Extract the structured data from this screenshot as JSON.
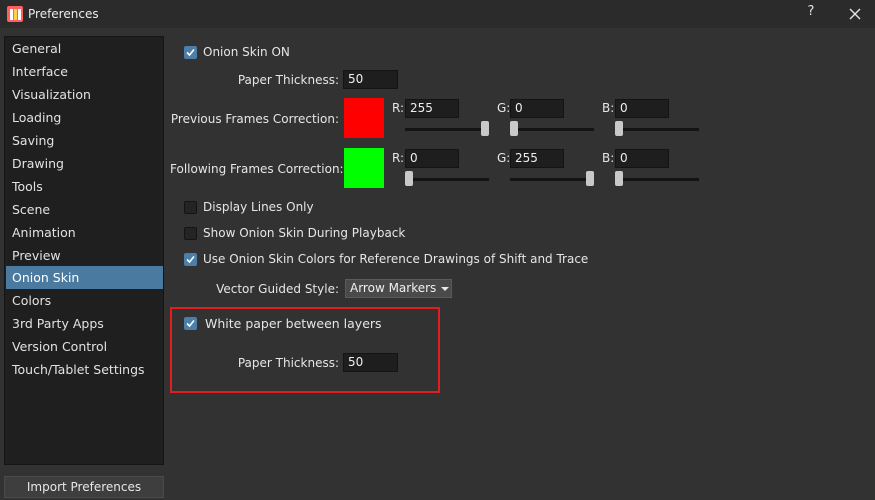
{
  "window": {
    "title": "Preferences",
    "help_label": "?"
  },
  "sidebar": {
    "items": [
      {
        "label": "General"
      },
      {
        "label": "Interface"
      },
      {
        "label": "Visualization"
      },
      {
        "label": "Loading"
      },
      {
        "label": "Saving"
      },
      {
        "label": "Drawing"
      },
      {
        "label": "Tools"
      },
      {
        "label": "Scene"
      },
      {
        "label": "Animation"
      },
      {
        "label": "Preview"
      },
      {
        "label": "Onion Skin"
      },
      {
        "label": "Colors"
      },
      {
        "label": "3rd Party Apps"
      },
      {
        "label": "Version Control"
      },
      {
        "label": "Touch/Tablet Settings"
      }
    ],
    "selected": "Onion Skin"
  },
  "footer": {
    "import_label": "Import Preferences"
  },
  "onion": {
    "onion_skin_on": {
      "label": "Onion Skin ON",
      "checked": true
    },
    "paper_thickness": {
      "label": "Paper Thickness:",
      "value": "50"
    },
    "previous": {
      "label": "Previous Frames Correction:",
      "color": "#ff0000",
      "r_label": "R:",
      "r": "255",
      "r_level": 1.0,
      "g_label": "G:",
      "g": "0",
      "g_level": 0.0,
      "b_label": "B:",
      "b": "0",
      "b_level": 0.0
    },
    "following": {
      "label": "Following Frames Correction:",
      "color": "#00ff00",
      "r_label": "R:",
      "r": "0",
      "r_level": 0.0,
      "g_label": "G:",
      "g": "255",
      "g_level": 1.0,
      "b_label": "B:",
      "b": "0",
      "b_level": 0.0
    },
    "display_lines_only": {
      "label": "Display Lines Only",
      "checked": false
    },
    "show_during_playback": {
      "label": "Show Onion Skin During Playback",
      "checked": false
    },
    "use_colors_reference": {
      "label": "Use Onion Skin Colors for Reference Drawings of Shift and Trace",
      "checked": true
    },
    "vector_guided": {
      "label": "Vector Guided Style:",
      "value": "Arrow Markers"
    },
    "white_paper": {
      "label": "White paper between layers",
      "checked": true
    },
    "paper_thickness_2": {
      "label": "Paper Thickness:",
      "value": "50"
    }
  },
  "colors": {
    "accent": "#4b7aa0",
    "highlight": "#e01e1e"
  }
}
